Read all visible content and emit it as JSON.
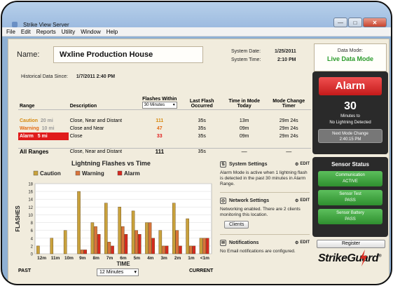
{
  "window": {
    "title": "Strike View Server"
  },
  "menu": [
    "File",
    "Edit",
    "Reports",
    "Utility",
    "Window",
    "Help"
  ],
  "header": {
    "name_label": "Name:",
    "name_value": "Wxline Production House",
    "system_date_label": "System Date:",
    "system_date": "1/25/2011",
    "system_time_label": "System Time:",
    "system_time": "2:10 PM",
    "data_mode_label": "Data Mode:",
    "data_mode_value": "Live Data Mode"
  },
  "historical": {
    "label": "Historical Data Since:",
    "value": "1/7/2011 2:40 PM"
  },
  "table": {
    "headers": {
      "range": "Range",
      "description": "Description",
      "flashes_within": "Flashes Within",
      "flashes_select": "30 Minutes",
      "last_flash_1": "Last Flash",
      "last_flash_2": "Occurred",
      "time_mode_1": "Time in Mode",
      "time_mode_2": "Today",
      "mode_change_1": "Mode Change",
      "mode_change_2": "Timer"
    },
    "rows": [
      {
        "range": "Caution",
        "dist": "20 mi",
        "desc": "Close, Near and Distant",
        "flashes": "111",
        "last": "35s",
        "time": "13m",
        "timer": "29m 24s"
      },
      {
        "range": "Warning",
        "dist": "10 mi",
        "desc": "Close and Near",
        "flashes": "47",
        "last": "35s",
        "time": "09m",
        "timer": "29m 24s"
      },
      {
        "range": "Alarm",
        "dist": "5 mi",
        "desc": "Close",
        "flashes": "33",
        "last": "35s",
        "time": "09m",
        "timer": "29m 24s"
      }
    ],
    "all": {
      "range": "All Ranges",
      "desc": "Close, Near and Distant",
      "flashes": "111",
      "last": "35s",
      "time": "—",
      "timer": "—"
    }
  },
  "chart_data": {
    "type": "bar",
    "title": "Lightning Flashes vs Time",
    "xlabel": "TIME",
    "ylabel": "FLASHES",
    "ylim": [
      0,
      18
    ],
    "yticks": [
      0,
      2,
      4,
      6,
      8,
      10,
      12,
      14,
      16,
      18
    ],
    "categories": [
      "12m",
      "11m",
      "10m",
      "9m",
      "8m",
      "7m",
      "6m",
      "5m",
      "4m",
      "3m",
      "2m",
      "1m",
      "<1m"
    ],
    "series": [
      {
        "name": "Caution",
        "color": "#c9a23c",
        "values": [
          2,
          4,
          6,
          16,
          8,
          13,
          12,
          11,
          8,
          6,
          13,
          9,
          4
        ]
      },
      {
        "name": "Warning",
        "color": "#d9743a",
        "values": [
          0,
          0,
          0,
          1,
          7,
          3,
          7,
          6,
          8,
          2,
          6,
          2,
          4
        ]
      },
      {
        "name": "Alarm",
        "color": "#d62a20",
        "values": [
          0,
          0,
          0,
          1,
          5,
          2,
          5,
          5,
          4,
          2,
          2,
          2,
          4
        ]
      }
    ],
    "legend": "top"
  },
  "chart_footer": {
    "past": "PAST",
    "current": "CURRENT",
    "interval": "12 Minutes"
  },
  "panels": {
    "system": {
      "title": "System Settings",
      "edit": "EDIT",
      "text": "Alarm Mode is active when 1 lightning flash is detected in the past 30 minutes in Alarm Range."
    },
    "network": {
      "title": "Network Settings",
      "edit": "EDIT",
      "text": "Networking enabled. There are 2 clients monitoring this location.",
      "clients_btn": "Clients"
    },
    "notifications": {
      "title": "Notifications",
      "edit": "EDIT",
      "text": "No Email notifications are configured."
    }
  },
  "alarm": {
    "label": "Alarm",
    "color": "#d62a20",
    "count": "30",
    "count_sub1": "Minutes to",
    "count_sub2": "No Lightning Detected",
    "next_label": "Next Mode Change",
    "next_time": "2:40:15 PM"
  },
  "sensor": {
    "title": "Sensor Status",
    "items": [
      {
        "label": "Communication",
        "status": "ACTIVE"
      },
      {
        "label": "Sensor Test",
        "status": "PASS"
      },
      {
        "label": "Sensor Battery",
        "status": "PASS"
      }
    ]
  },
  "register_label": "Register",
  "logo": {
    "part1": "Strike",
    "part2": "Guard",
    "mark": "®"
  }
}
